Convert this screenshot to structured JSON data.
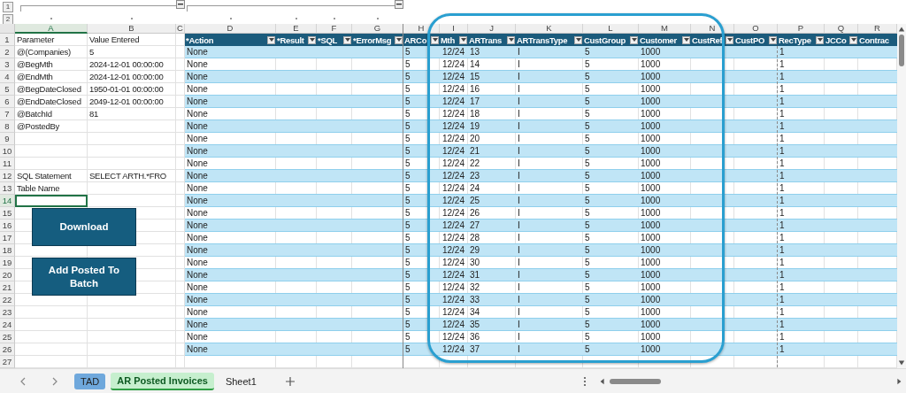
{
  "outline_levels": [
    "1",
    "2"
  ],
  "column_headers": [
    {
      "label": "A",
      "selected": true
    },
    {
      "label": "B",
      "selected": false
    },
    {
      "label": "C",
      "selected": false
    },
    {
      "label": "D",
      "selected": false
    },
    {
      "label": "E",
      "selected": false
    },
    {
      "label": "F",
      "selected": false
    },
    {
      "label": "G",
      "selected": false
    },
    {
      "label": "H",
      "selected": false
    },
    {
      "label": "I",
      "selected": false
    },
    {
      "label": "J",
      "selected": false
    },
    {
      "label": "K",
      "selected": false
    },
    {
      "label": "L",
      "selected": false
    },
    {
      "label": "M",
      "selected": false
    },
    {
      "label": "N",
      "selected": false
    },
    {
      "label": "O",
      "selected": false
    },
    {
      "label": "P",
      "selected": false
    },
    {
      "label": "Q",
      "selected": false
    },
    {
      "label": "R",
      "selected": false
    }
  ],
  "row_headers": [
    {
      "label": "1",
      "selected": false
    },
    {
      "label": "2",
      "selected": false
    },
    {
      "label": "3",
      "selected": false
    },
    {
      "label": "4",
      "selected": false
    },
    {
      "label": "5",
      "selected": false
    },
    {
      "label": "6",
      "selected": false
    },
    {
      "label": "7",
      "selected": false
    },
    {
      "label": "8",
      "selected": false
    },
    {
      "label": "9",
      "selected": false
    },
    {
      "label": "10",
      "selected": false
    },
    {
      "label": "11",
      "selected": false
    },
    {
      "label": "12",
      "selected": false
    },
    {
      "label": "13",
      "selected": false
    },
    {
      "label": "14",
      "selected": true
    },
    {
      "label": "15",
      "selected": false
    },
    {
      "label": "16",
      "selected": false
    },
    {
      "label": "17",
      "selected": false
    },
    {
      "label": "18",
      "selected": false
    },
    {
      "label": "19",
      "selected": false
    },
    {
      "label": "20",
      "selected": false
    },
    {
      "label": "21",
      "selected": false
    },
    {
      "label": "22",
      "selected": false
    },
    {
      "label": "23",
      "selected": false
    },
    {
      "label": "24",
      "selected": false
    },
    {
      "label": "25",
      "selected": false
    },
    {
      "label": "26",
      "selected": false
    },
    {
      "label": "27",
      "selected": false
    }
  ],
  "parameters": [
    {
      "name": "Parameter",
      "value": "Value Entered"
    },
    {
      "name": "@(Companies)",
      "value": "5"
    },
    {
      "name": "@BegMth",
      "value": "2024-12-01 00:00:00"
    },
    {
      "name": "@EndMth",
      "value": "2024-12-01 00:00:00"
    },
    {
      "name": "@BegDateClosed",
      "value": "1950-01-01 00:00:00"
    },
    {
      "name": "@EndDateClosed",
      "value": "2049-12-01 00:00:00"
    },
    {
      "name": "@BatchId",
      "value": "81"
    },
    {
      "name": "@PostedBy"
    }
  ],
  "sql_statement": {
    "label": "SQL Statement",
    "value": "SELECT ARTH.*FRO"
  },
  "table_name": {
    "label": "Table Name"
  },
  "buttons": [
    {
      "label": "Download"
    },
    {
      "label": "Add Posted To Batch"
    }
  ],
  "table": {
    "columns": [
      "*Action",
      "*Result",
      "*SQL",
      "*ErrorMsg",
      "ARCo",
      "Mth",
      "ARTrans",
      "ARTransType",
      "CustGroup",
      "Customer",
      "CustRef",
      "CustPO",
      "RecType",
      "JCCo",
      "Contrac"
    ],
    "rows": [
      {
        "action": "None",
        "arco": "5",
        "mth": "12/24",
        "artrans": "13",
        "artranstype": "I",
        "custgroup": "5",
        "customer": "1000",
        "rectype": "1"
      },
      {
        "action": "None",
        "arco": "5",
        "mth": "12/24",
        "artrans": "14",
        "artranstype": "I",
        "custgroup": "5",
        "customer": "1000",
        "rectype": "1"
      },
      {
        "action": "None",
        "arco": "5",
        "mth": "12/24",
        "artrans": "15",
        "artranstype": "I",
        "custgroup": "5",
        "customer": "1000",
        "rectype": "1"
      },
      {
        "action": "None",
        "arco": "5",
        "mth": "12/24",
        "artrans": "16",
        "artranstype": "I",
        "custgroup": "5",
        "customer": "1000",
        "rectype": "1"
      },
      {
        "action": "None",
        "arco": "5",
        "mth": "12/24",
        "artrans": "17",
        "artranstype": "I",
        "custgroup": "5",
        "customer": "1000",
        "rectype": "1"
      },
      {
        "action": "None",
        "arco": "5",
        "mth": "12/24",
        "artrans": "18",
        "artranstype": "I",
        "custgroup": "5",
        "customer": "1000",
        "rectype": "1"
      },
      {
        "action": "None",
        "arco": "5",
        "mth": "12/24",
        "artrans": "19",
        "artranstype": "I",
        "custgroup": "5",
        "customer": "1000",
        "rectype": "1"
      },
      {
        "action": "None",
        "arco": "5",
        "mth": "12/24",
        "artrans": "20",
        "artranstype": "I",
        "custgroup": "5",
        "customer": "1000",
        "rectype": "1"
      },
      {
        "action": "None",
        "arco": "5",
        "mth": "12/24",
        "artrans": "21",
        "artranstype": "I",
        "custgroup": "5",
        "customer": "1000",
        "rectype": "1"
      },
      {
        "action": "None",
        "arco": "5",
        "mth": "12/24",
        "artrans": "22",
        "artranstype": "I",
        "custgroup": "5",
        "customer": "1000",
        "rectype": "1"
      },
      {
        "action": "None",
        "arco": "5",
        "mth": "12/24",
        "artrans": "23",
        "artranstype": "I",
        "custgroup": "5",
        "customer": "1000",
        "rectype": "1"
      },
      {
        "action": "None",
        "arco": "5",
        "mth": "12/24",
        "artrans": "24",
        "artranstype": "I",
        "custgroup": "5",
        "customer": "1000",
        "rectype": "1"
      },
      {
        "action": "None",
        "arco": "5",
        "mth": "12/24",
        "artrans": "25",
        "artranstype": "I",
        "custgroup": "5",
        "customer": "1000",
        "rectype": "1"
      },
      {
        "action": "None",
        "arco": "5",
        "mth": "12/24",
        "artrans": "26",
        "artranstype": "I",
        "custgroup": "5",
        "customer": "1000",
        "rectype": "1"
      },
      {
        "action": "None",
        "arco": "5",
        "mth": "12/24",
        "artrans": "27",
        "artranstype": "I",
        "custgroup": "5",
        "customer": "1000",
        "rectype": "1"
      },
      {
        "action": "None",
        "arco": "5",
        "mth": "12/24",
        "artrans": "28",
        "artranstype": "I",
        "custgroup": "5",
        "customer": "1000",
        "rectype": "1"
      },
      {
        "action": "None",
        "arco": "5",
        "mth": "12/24",
        "artrans": "29",
        "artranstype": "I",
        "custgroup": "5",
        "customer": "1000",
        "rectype": "1"
      },
      {
        "action": "None",
        "arco": "5",
        "mth": "12/24",
        "artrans": "30",
        "artranstype": "I",
        "custgroup": "5",
        "customer": "1000",
        "rectype": "1"
      },
      {
        "action": "None",
        "arco": "5",
        "mth": "12/24",
        "artrans": "31",
        "artranstype": "I",
        "custgroup": "5",
        "customer": "1000",
        "rectype": "1"
      },
      {
        "action": "None",
        "arco": "5",
        "mth": "12/24",
        "artrans": "32",
        "artranstype": "I",
        "custgroup": "5",
        "customer": "1000",
        "rectype": "1"
      },
      {
        "action": "None",
        "arco": "5",
        "mth": "12/24",
        "artrans": "33",
        "artranstype": "I",
        "custgroup": "5",
        "customer": "1000",
        "rectype": "1"
      },
      {
        "action": "None",
        "arco": "5",
        "mth": "12/24",
        "artrans": "34",
        "artranstype": "I",
        "custgroup": "5",
        "customer": "1000",
        "rectype": "1"
      },
      {
        "action": "None",
        "arco": "5",
        "mth": "12/24",
        "artrans": "35",
        "artranstype": "I",
        "custgroup": "5",
        "customer": "1000",
        "rectype": "1"
      },
      {
        "action": "None",
        "arco": "5",
        "mth": "12/24",
        "artrans": "36",
        "artranstype": "I",
        "custgroup": "5",
        "customer": "1000",
        "rectype": "1"
      },
      {
        "action": "None",
        "arco": "5",
        "mth": "12/24",
        "artrans": "37",
        "artranstype": "I",
        "custgroup": "5",
        "customer": "1000",
        "rectype": "1"
      }
    ]
  },
  "sheet_tabs": [
    {
      "label": "TAD",
      "selected": false,
      "color": "#6fa8dc"
    },
    {
      "label": "AR Posted Invoices",
      "selected": true,
      "color": "#c6efce"
    },
    {
      "label": "Sheet1",
      "selected": false
    }
  ]
}
